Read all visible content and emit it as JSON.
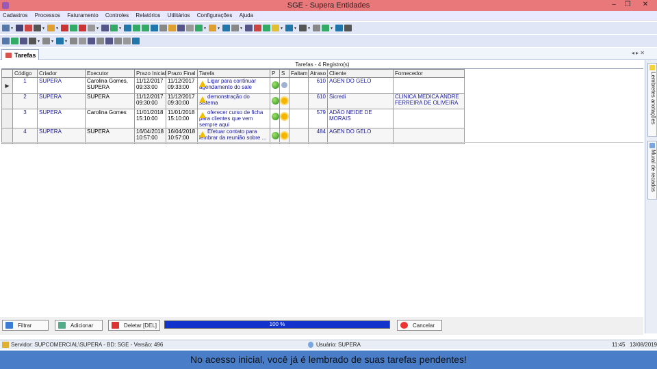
{
  "window": {
    "title": "SGE - Supera Entidades"
  },
  "menu": [
    "Cadastros",
    "Processos",
    "Faturamento",
    "Controles",
    "Relatórios",
    "Utilitários",
    "Configurações",
    "Ajuda"
  ],
  "tab": {
    "label": "Tarefas"
  },
  "grid": {
    "title": "Tarefas - 4 Registro(s)",
    "columns": [
      "Código",
      "Criador",
      "Executor",
      "Prazo Inicial",
      "Prazo Final",
      "Tarefa",
      "P",
      "S",
      "Faltam",
      "Atraso",
      "Cliente",
      "Fornecedor"
    ],
    "rows": [
      {
        "indicator": "▶",
        "codigo": "1",
        "criador": "SUPERA",
        "executor": "Carolina Gomes, SUPERA",
        "prazo_inicial": "11/12/2017 09:33:00",
        "prazo_final": "11/12/2017 09:33:00",
        "tarefa": "Ligar para continuar agendamento do sale",
        "faltam": "",
        "atraso": "610",
        "cliente": "AGEN DO GELO",
        "fornecedor": "",
        "status": "gray"
      },
      {
        "indicator": "",
        "codigo": "2",
        "criador": "SUPERA",
        "executor": "SUPERA",
        "prazo_inicial": "11/12/2017 09:30:00",
        "prazo_final": "11/12/2017 09:30:00",
        "tarefa": "demonstração do sistema",
        "faltam": "",
        "atraso": "610",
        "cliente": "Sicredi",
        "fornecedor": "CLINICA MEDICA ANDRE FERREIRA DE OLIVEIRA",
        "status": "sun"
      },
      {
        "indicator": "",
        "codigo": "3",
        "criador": "SUPERA",
        "executor": "Carolina Gomes",
        "prazo_inicial": "11/01/2018 15:10:00",
        "prazo_final": "11/01/2018 15:10:00",
        "tarefa": "oferecer curso de ficha para clientes que vem sempre aqui",
        "faltam": "",
        "atraso": "579",
        "cliente": "ADÃO NEIDE DE MORAIS",
        "fornecedor": "",
        "status": "sun"
      },
      {
        "indicator": "",
        "codigo": "4",
        "criador": "SUPERA",
        "executor": "SUPERA",
        "prazo_inicial": "16/04/2018 10:57:00",
        "prazo_final": "16/04/2018 10:57:00",
        "tarefa": "Efetuar contato para lembrar da reunião sobre ...",
        "faltam": "",
        "atraso": "484",
        "cliente": "AGEN DO GELO",
        "fornecedor": "",
        "status": "sun"
      }
    ]
  },
  "rightpanel": {
    "tab1": "Lembretes anotações",
    "tab2": "Mural de recados"
  },
  "bottom": {
    "filtrar": "Filtrar",
    "adicionar": "Adicionar",
    "deletar": "Deletar [DEL]",
    "progress_text": "100 %",
    "progress_value": 100,
    "cancelar": "Cancelar"
  },
  "status": {
    "servidor": "Servidor: SUPCOMERCIAL\\SUPERA - BD: SGE - Versão: 496",
    "usuario": "Usuário: SUPERA",
    "time": "11:45",
    "date": "13/08/2019"
  },
  "caption": "No acesso inicial, você já é lembrado de suas tarefas pendentes!",
  "colors": {
    "titlebar": "#e9787a",
    "caption_bg": "#4a7dc8",
    "progress": "#1133cc"
  }
}
